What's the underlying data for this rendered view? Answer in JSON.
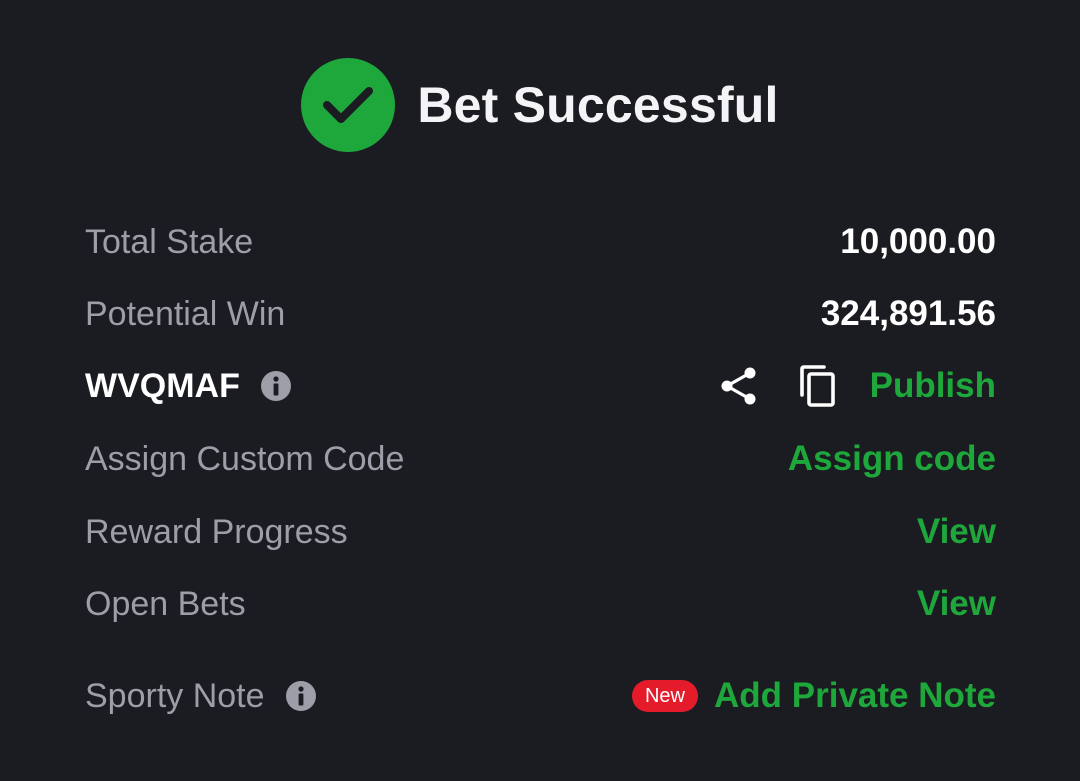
{
  "header": {
    "title": "Bet Successful",
    "icon": "check-circle-icon"
  },
  "rows": {
    "total_stake": {
      "label": "Total Stake",
      "value": "10,000.00"
    },
    "potential_win": {
      "label": "Potential Win",
      "value": "324,891.56"
    },
    "booking_code": {
      "code": "WVQMAF",
      "publish_label": "Publish"
    },
    "custom_code": {
      "label": "Assign Custom Code",
      "action": "Assign code"
    },
    "reward_progress": {
      "label": "Reward Progress",
      "action": "View"
    },
    "open_bets": {
      "label": "Open Bets",
      "action": "View"
    },
    "sporty_note": {
      "label": "Sporty Note",
      "badge": "New",
      "action": "Add Private Note"
    }
  },
  "colors": {
    "background": "#1b1c21",
    "accent_green": "#1ea83c",
    "label_gray": "#9c9ea8",
    "badge_red": "#e41b2b"
  }
}
